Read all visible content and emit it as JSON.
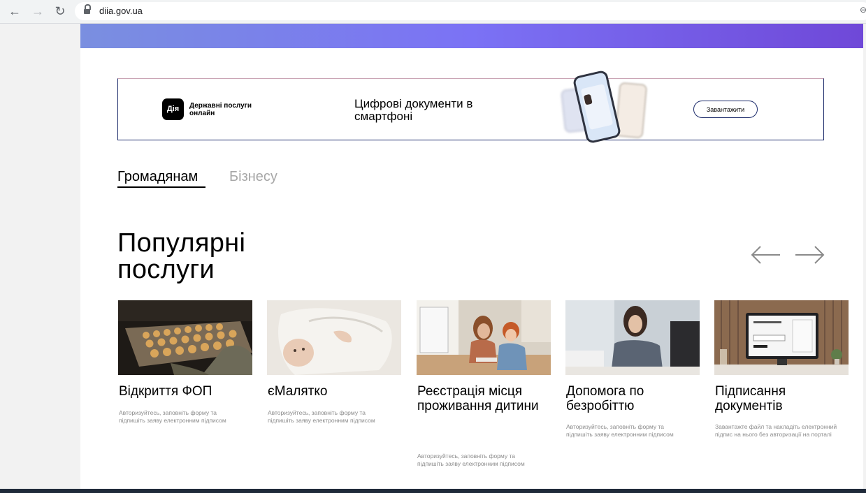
{
  "browser": {
    "url": "diia.gov.ua",
    "back_icon": "←",
    "forward_icon": "→",
    "reload_icon": "↻",
    "zoom_icon": "⊖"
  },
  "banner": {
    "logo_text": "Дія",
    "label": "Державні послуги онлайн",
    "headline": "Цифрові документи в смартфоні",
    "download_label": "Завантажити"
  },
  "tabs": [
    {
      "label": "Громадянам",
      "active": true
    },
    {
      "label": "Бізнесу",
      "active": false
    }
  ],
  "section": {
    "title": "Популярні послуги"
  },
  "cards": [
    {
      "title": "Відкриття ФОП",
      "desc": "Авторизуйтесь, заповніть форму та підпишіть заяву електронним підписом"
    },
    {
      "title": "єМалятко",
      "desc": "Авторизуйтесь, заповніть форму та підпишіть заяву електронним підписом"
    },
    {
      "title": "Реєстрація місця проживання дитини",
      "desc": "Авторизуйтесь, заповніть форму та підпишіть заяву електронним підписом"
    },
    {
      "title": "Допомога по безробіттю",
      "desc": "Авторизуйтесь, заповніть форму та підпишіть заяву електронним підписом"
    },
    {
      "title": "Підписання документів",
      "desc": "Завантажте файл та накладіть електронний підпис на нього без авторизації на порталі"
    }
  ]
}
